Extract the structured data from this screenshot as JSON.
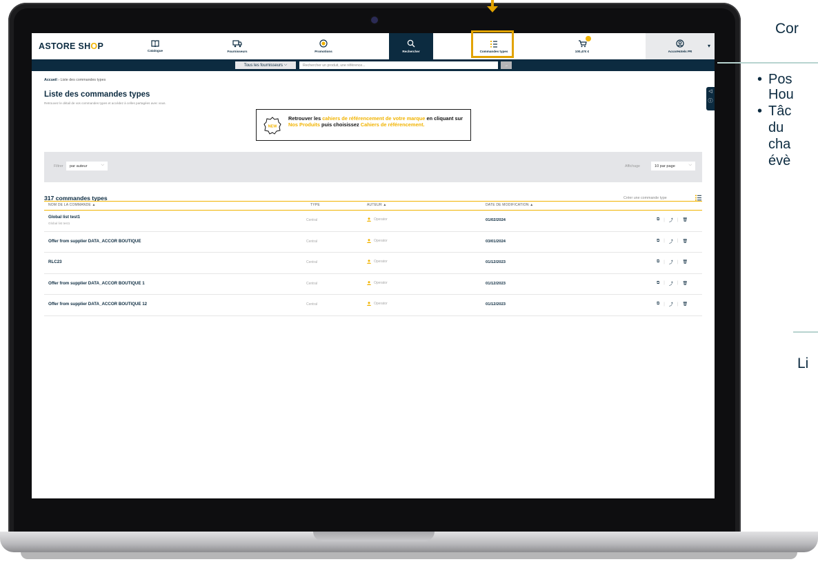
{
  "app": {
    "logo_prefix": "ASTORE SH",
    "logo_accent": "O",
    "logo_suffix": "P"
  },
  "nav": {
    "items": [
      {
        "label": "Catalogue",
        "icon": "book-icon"
      },
      {
        "label": "Fournisseurs",
        "icon": "truck-icon"
      },
      {
        "label": "Promotions",
        "icon": "percent-badge-icon"
      },
      {
        "label": "Rechercher",
        "icon": "search-icon"
      },
      {
        "label": "Commandes types",
        "icon": "list-icon"
      },
      {
        "label": "100,47€ €",
        "icon": "cart-icon"
      },
      {
        "label": "AccorHotels PR",
        "icon": "account-icon"
      }
    ]
  },
  "search": {
    "supplier_select": "Tous les fournisseurs",
    "placeholder": "Rechercher un produit, une référence...",
    "go": "→"
  },
  "page": {
    "breadcrumb_home": "Accueil",
    "breadcrumb_sep": " › ",
    "breadcrumb_current": "Liste des commandes types",
    "title": "Liste des commandes types",
    "subtitle": "Retrouvez le détail de vos commandes types et accédez à celles partagées avec vous."
  },
  "banner": {
    "t1": "Retrouver les ",
    "t2": "cahiers de référencement de votre marque",
    "t3": " en cliquant sur ",
    "t4": "Nos Produits",
    "t5": " puis choisissez ",
    "t6": "Cahiers de référencement",
    "t7": ".",
    "badge": "NEW"
  },
  "filters": {
    "label": "Filtrer",
    "value": "par auteur",
    "display_label": "Affichage",
    "display_value": "10 par page"
  },
  "list": {
    "count_title": "317 commandes types",
    "create_label": "Créer une commande type",
    "headers": {
      "name": "NOM DE LA COMMANDE ▲",
      "type": "TYPE",
      "author": "AUTEUR ▲",
      "date": "DATE DE MODIFICATION ▲"
    },
    "rows": [
      {
        "name": "Global list test1",
        "sub": "Global list test1",
        "type": "Central",
        "author": "Operator",
        "date": "01/02/2024"
      },
      {
        "name": "Offer from supplier DATA_ACCOR BOUTIQUE",
        "sub": "",
        "type": "Central",
        "author": "Operator",
        "date": "03/01/2024"
      },
      {
        "name": "RLC23",
        "sub": "",
        "type": "Central",
        "author": "Operator",
        "date": "01/12/2023"
      },
      {
        "name": "Offer from supplier DATA_ACCOR BOUTIQUE 1",
        "sub": "",
        "type": "Central",
        "author": "Operator",
        "date": "01/12/2023"
      },
      {
        "name": "Offer from supplier DATA_ACCOR BOUTIQUE 12",
        "sub": "",
        "type": "Central",
        "author": "Operator",
        "date": "01/12/2023"
      }
    ]
  },
  "side_panel": {
    "top_icon": "megaphone-icon",
    "bottom_icon": "info-icon"
  },
  "annotation": {
    "title_partial": "Cor",
    "bullet1_line1": "Pos",
    "bullet1_line2": "Hou",
    "bullet2_line1": "Tâc",
    "bullet2_line2": "du",
    "bullet2_line3": "cha",
    "bullet2_line4": "évè",
    "title2_partial": "Li",
    "highlight_color": "#e2a300"
  },
  "colors": {
    "brand_dark": "#0c2b40",
    "accent": "#f1b300"
  }
}
